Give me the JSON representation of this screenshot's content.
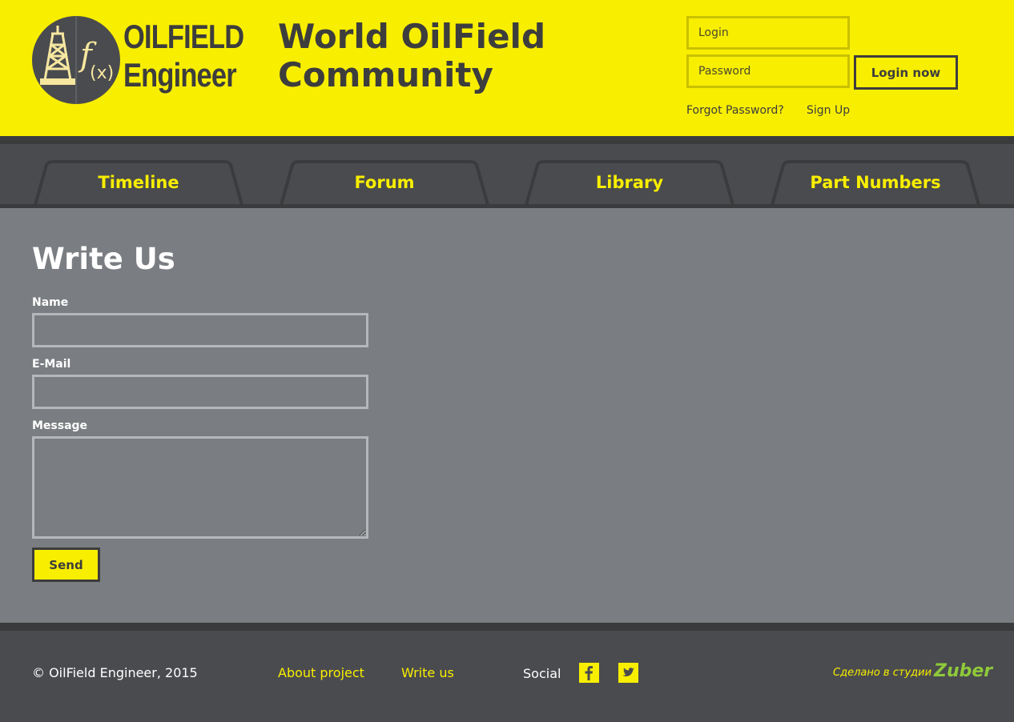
{
  "header": {
    "logo": {
      "line1": "OILFIELD",
      "line2": "Engineer",
      "formula": "f(x)"
    },
    "site_title_line1": "World OilField",
    "site_title_line2": "Community",
    "login": {
      "login_placeholder": "Login",
      "password_placeholder": "Password",
      "button_label": "Login now",
      "forgot_label": "Forgot Password?",
      "signup_label": "Sign Up"
    }
  },
  "nav": {
    "tabs": [
      {
        "label": "Timeline"
      },
      {
        "label": "Forum"
      },
      {
        "label": "Library"
      },
      {
        "label": "Part Numbers"
      }
    ]
  },
  "main": {
    "title": "Write Us",
    "form": {
      "name_label": "Name",
      "email_label": "E-Mail",
      "message_label": "Message",
      "name_value": "",
      "email_value": "",
      "message_value": "",
      "send_label": "Send"
    }
  },
  "footer": {
    "copyright": "© OilField Engineer, 2015",
    "links": [
      {
        "label": "About project"
      },
      {
        "label": "Write us"
      }
    ],
    "social_label": "Social",
    "social_icons": [
      "facebook-icon",
      "twitter-icon"
    ],
    "credit_text": "Сделано в студии",
    "credit_logo": "Zuber"
  },
  "colors": {
    "brand_yellow": "#f8ee00",
    "dark_gray": "#4a4b4e",
    "content_gray": "#7a7d81",
    "text_dark": "#3d3d3d",
    "credit_green": "#8fc93a"
  }
}
